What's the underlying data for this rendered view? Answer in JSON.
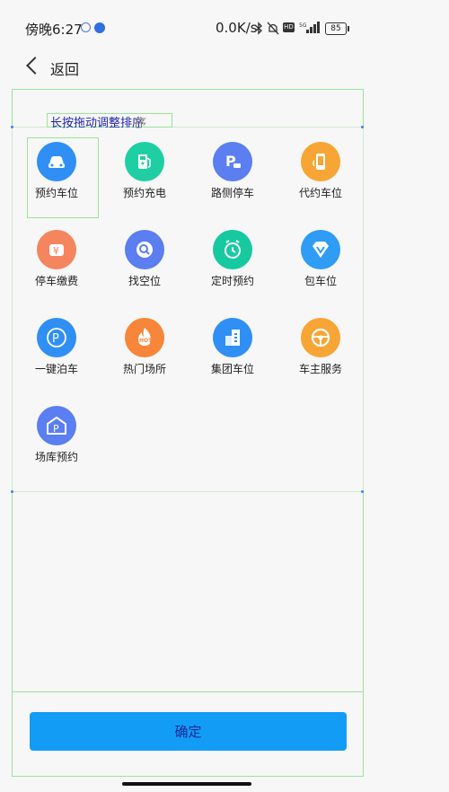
{
  "statusbar": {
    "time": "傍晚6:27",
    "speed": "0.0K/s",
    "battery": "85"
  },
  "header": {
    "back_label": "返回"
  },
  "hint": {
    "text": "长按拖动调整排序",
    "ghost": "序"
  },
  "items": [
    {
      "label": "预约车位",
      "color": "#2f8ff5",
      "icon": "car-icon"
    },
    {
      "label": "预约充电",
      "color": "#1fcfa3",
      "icon": "charging-station-icon"
    },
    {
      "label": "路侧停车",
      "color": "#5b7ef0",
      "icon": "parking-sign-icon"
    },
    {
      "label": "代约车位",
      "color": "#f7a534",
      "icon": "phone-icon"
    },
    {
      "label": "停车缴费",
      "color": "#f5855f",
      "icon": "yuan-icon"
    },
    {
      "label": "找空位",
      "color": "#5b7ef0",
      "icon": "search-icon"
    },
    {
      "label": "定时预约",
      "color": "#16c9a0",
      "icon": "alarm-clock-icon"
    },
    {
      "label": "包车位",
      "color": "#2f9cf5",
      "icon": "vip-diamond-icon"
    },
    {
      "label": "一键泊车",
      "color": "#2f8ff5",
      "icon": "parking-circle-icon"
    },
    {
      "label": "热门场所",
      "color": "#f7863a",
      "icon": "hot-flame-icon"
    },
    {
      "label": "集团车位",
      "color": "#2f8ff5",
      "icon": "building-icon"
    },
    {
      "label": "车主服务",
      "color": "#f7a534",
      "icon": "steering-wheel-icon"
    },
    {
      "label": "场库预约",
      "color": "#5b7ef0",
      "icon": "garage-icon"
    }
  ],
  "confirm_label": "确定"
}
